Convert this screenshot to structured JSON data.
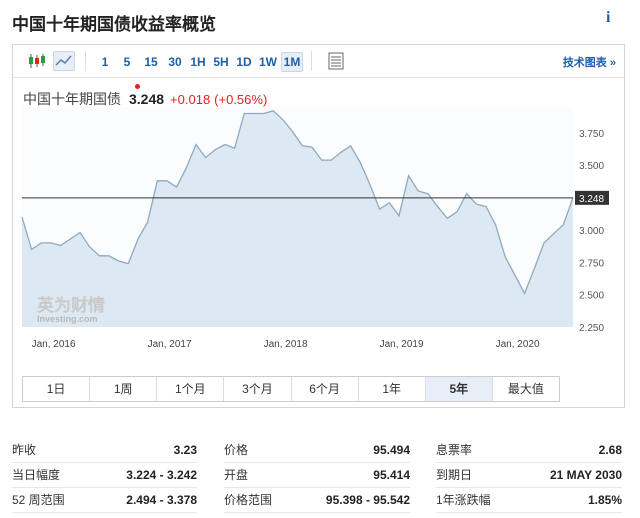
{
  "page": {
    "title": "中国十年期国债收益率概览",
    "info_icon": "i"
  },
  "toolbar": {
    "intervals": [
      "1",
      "5",
      "15",
      "30",
      "1H",
      "5H",
      "1D",
      "1W",
      "1M"
    ],
    "selected_interval": "1M",
    "technical_link": "技术图表 »"
  },
  "quote": {
    "name": "中国十年期国债",
    "last": "3.248",
    "change": "+0.018",
    "change_pct": "(+0.56%)",
    "status_color": "#e0231c"
  },
  "chart_data": {
    "type": "area",
    "x_ticks": [
      "Jan, 2016",
      "Jan, 2017",
      "Jan, 2018",
      "Jan, 2019",
      "Jan, 2020"
    ],
    "y_ticks": [
      "3.750",
      "3.500",
      "3.250",
      "3.000",
      "2.750",
      "2.500",
      "2.250"
    ],
    "ylim": [
      2.25,
      3.95
    ],
    "xlim": [
      2015.917,
      2020.667
    ],
    "current_value_label": "3.248",
    "current_value": 3.248,
    "series": [
      {
        "values": [
          [
            2015.917,
            3.1
          ],
          [
            2016.0,
            2.85
          ],
          [
            2016.083,
            2.9
          ],
          [
            2016.167,
            2.9
          ],
          [
            2016.25,
            2.88
          ],
          [
            2016.333,
            2.93
          ],
          [
            2016.417,
            2.98
          ],
          [
            2016.5,
            2.87
          ],
          [
            2016.583,
            2.8
          ],
          [
            2016.667,
            2.8
          ],
          [
            2016.75,
            2.76
          ],
          [
            2016.833,
            2.74
          ],
          [
            2016.917,
            2.93
          ],
          [
            2017.0,
            3.06
          ],
          [
            2017.083,
            3.38
          ],
          [
            2017.167,
            3.38
          ],
          [
            2017.25,
            3.33
          ],
          [
            2017.333,
            3.48
          ],
          [
            2017.417,
            3.66
          ],
          [
            2017.5,
            3.56
          ],
          [
            2017.583,
            3.62
          ],
          [
            2017.667,
            3.66
          ],
          [
            2017.75,
            3.63
          ],
          [
            2017.833,
            3.9
          ],
          [
            2017.917,
            3.9
          ],
          [
            2018.0,
            3.9
          ],
          [
            2018.083,
            3.92
          ],
          [
            2018.167,
            3.85
          ],
          [
            2018.25,
            3.76
          ],
          [
            2018.333,
            3.65
          ],
          [
            2018.417,
            3.64
          ],
          [
            2018.5,
            3.54
          ],
          [
            2018.583,
            3.54
          ],
          [
            2018.667,
            3.6
          ],
          [
            2018.75,
            3.65
          ],
          [
            2018.833,
            3.52
          ],
          [
            2018.917,
            3.35
          ],
          [
            2019.0,
            3.16
          ],
          [
            2019.083,
            3.21
          ],
          [
            2019.167,
            3.11
          ],
          [
            2019.25,
            3.42
          ],
          [
            2019.333,
            3.3
          ],
          [
            2019.417,
            3.28
          ],
          [
            2019.5,
            3.18
          ],
          [
            2019.583,
            3.09
          ],
          [
            2019.667,
            3.14
          ],
          [
            2019.75,
            3.28
          ],
          [
            2019.833,
            3.2
          ],
          [
            2019.917,
            3.18
          ],
          [
            2020.0,
            3.04
          ],
          [
            2020.083,
            2.79
          ],
          [
            2020.167,
            2.65
          ],
          [
            2020.25,
            2.51
          ],
          [
            2020.333,
            2.7
          ],
          [
            2020.417,
            2.9
          ],
          [
            2020.5,
            2.97
          ],
          [
            2020.583,
            3.04
          ],
          [
            2020.667,
            3.25
          ]
        ]
      }
    ],
    "colors": {
      "line": "#8fa9bf",
      "fill": "#dde9f2",
      "current_line": "#333333"
    },
    "grid": false
  },
  "watermark": {
    "brand": "英为财情",
    "sub": "Investing.com"
  },
  "ranges": {
    "items": [
      "1日",
      "1周",
      "1个月",
      "3个月",
      "6个月",
      "1年",
      "5年",
      "最大值"
    ],
    "selected": "5年"
  },
  "stats": [
    {
      "label": "昨收",
      "value": "3.23"
    },
    {
      "label": "价格",
      "value": "95.494"
    },
    {
      "label": "息票率",
      "value": "2.68"
    },
    {
      "label": "当日幅度",
      "value": "3.224 - 3.242"
    },
    {
      "label": "开盘",
      "value": "95.414"
    },
    {
      "label": "到期日",
      "value": "21 MAY 2030"
    },
    {
      "label": "52 周范围",
      "value": "2.494 - 3.378"
    },
    {
      "label": "价格范围",
      "value": "95.398 - 95.542"
    },
    {
      "label": "1年涨跌幅",
      "value": "1.85%"
    }
  ]
}
